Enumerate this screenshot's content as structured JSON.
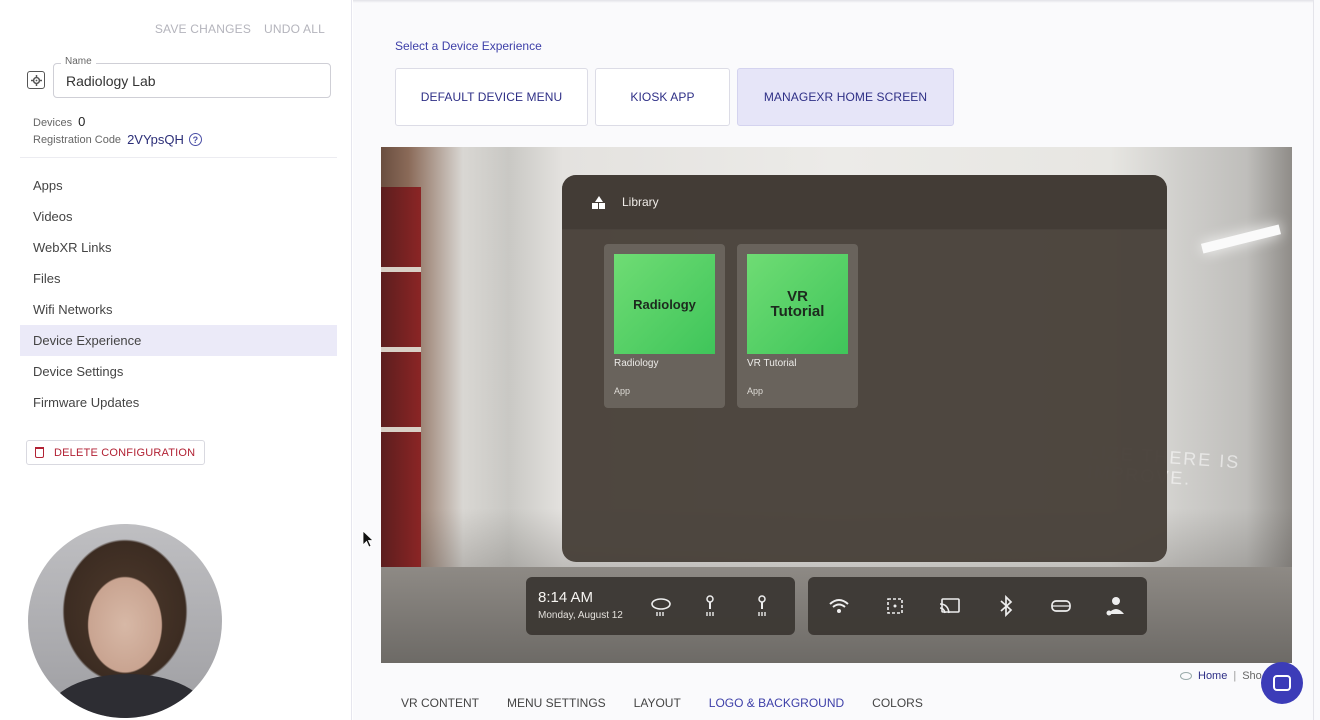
{
  "sidebar": {
    "save_changes": "SAVE CHANGES",
    "undo_all": "UNDO ALL",
    "name_label": "Name",
    "name_value": "Radiology Lab",
    "devices_label": "Devices",
    "devices_count": "0",
    "registration_label": "Registration Code",
    "registration_code": "2VYpsQH",
    "help_glyph": "?",
    "nav": [
      {
        "label": "Apps"
      },
      {
        "label": "Videos"
      },
      {
        "label": "WebXR Links"
      },
      {
        "label": "Files"
      },
      {
        "label": "Wifi Networks"
      },
      {
        "label": "Device Experience",
        "active": true
      },
      {
        "label": "Device Settings"
      },
      {
        "label": "Firmware Updates"
      }
    ],
    "delete_label": "DELETE CONFIGURATION"
  },
  "main": {
    "select_label": "Select a Device Experience",
    "experience_options": [
      {
        "label": "DEFAULT DEVICE MENU"
      },
      {
        "label": "KIOSK APP"
      },
      {
        "label": "MANAGEXR HOME SCREEN",
        "active": true
      }
    ],
    "library": {
      "title": "Library",
      "apps": [
        {
          "thumb_text": "Radiology",
          "name": "Radiology",
          "type": "App"
        },
        {
          "thumb_text": "VR Tutorial",
          "name": "VR Tutorial",
          "type": "App"
        }
      ]
    },
    "taskbar": {
      "time": "8:14 AM",
      "date": "Monday, August 12",
      "left_icons": [
        "headset-icon",
        "left-controller-icon",
        "right-controller-icon"
      ],
      "right_icons": [
        "wifi-icon",
        "boundary-icon",
        "cast-icon",
        "bluetooth-icon",
        "vr-headset-icon",
        "user-settings-icon"
      ]
    },
    "wall_text": [
      "LIZE THERE IS",
      "IMPROVE."
    ],
    "footer": {
      "home": "Home",
      "separator": "|",
      "show": "Sho"
    },
    "tabs": [
      {
        "label": "VR CONTENT"
      },
      {
        "label": "MENU SETTINGS"
      },
      {
        "label": "LAYOUT"
      },
      {
        "label": "LOGO & BACKGROUND",
        "active": true
      },
      {
        "label": "COLORS"
      }
    ]
  },
  "colors": {
    "accent": "#3d3fa8",
    "active_bg": "#ebeaf8",
    "danger": "#b22234",
    "app_green": "#4fd063"
  }
}
